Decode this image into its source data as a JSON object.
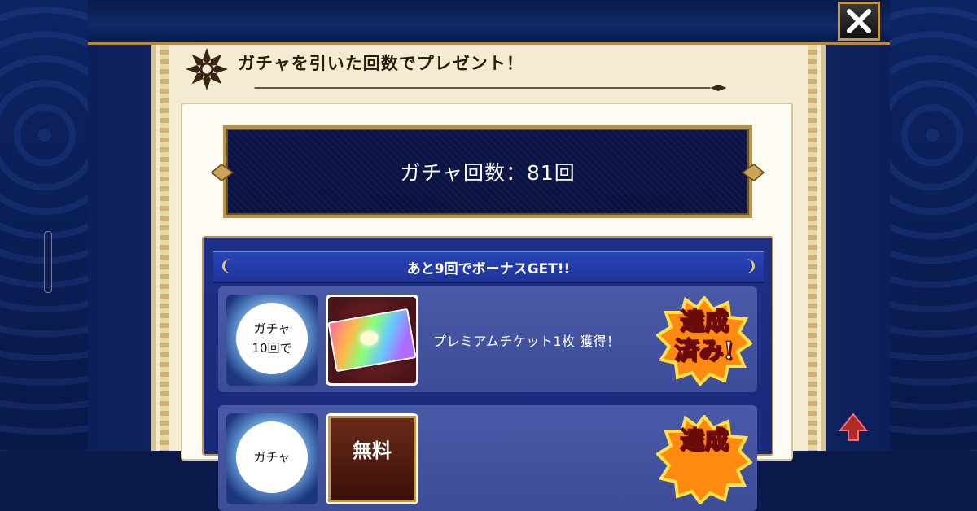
{
  "header": {
    "title": "ガチャを引いた回数でプレゼント！"
  },
  "close_button": {
    "symbol": "✕"
  },
  "gacha_count": {
    "text": "ガチャ回数：81回"
  },
  "bonus": {
    "banner": "あと9回でボーナスGET!!"
  },
  "rewards": [
    {
      "orb_line1": "ガチャ",
      "orb_line2": "10回で",
      "description": "プレミアムチケット1枚 獲得！",
      "status_line1": "達成",
      "status_line2": "済み!"
    },
    {
      "orb_line1": "ガチャ",
      "item_label": "無料",
      "status_line1": "達成"
    }
  ],
  "colors": {
    "gold": "#b89448",
    "navy": "#0c1448",
    "paper": "#f3ecd2",
    "row_blue": "#4a5aa8",
    "badge_orange": "#ff8a10"
  }
}
